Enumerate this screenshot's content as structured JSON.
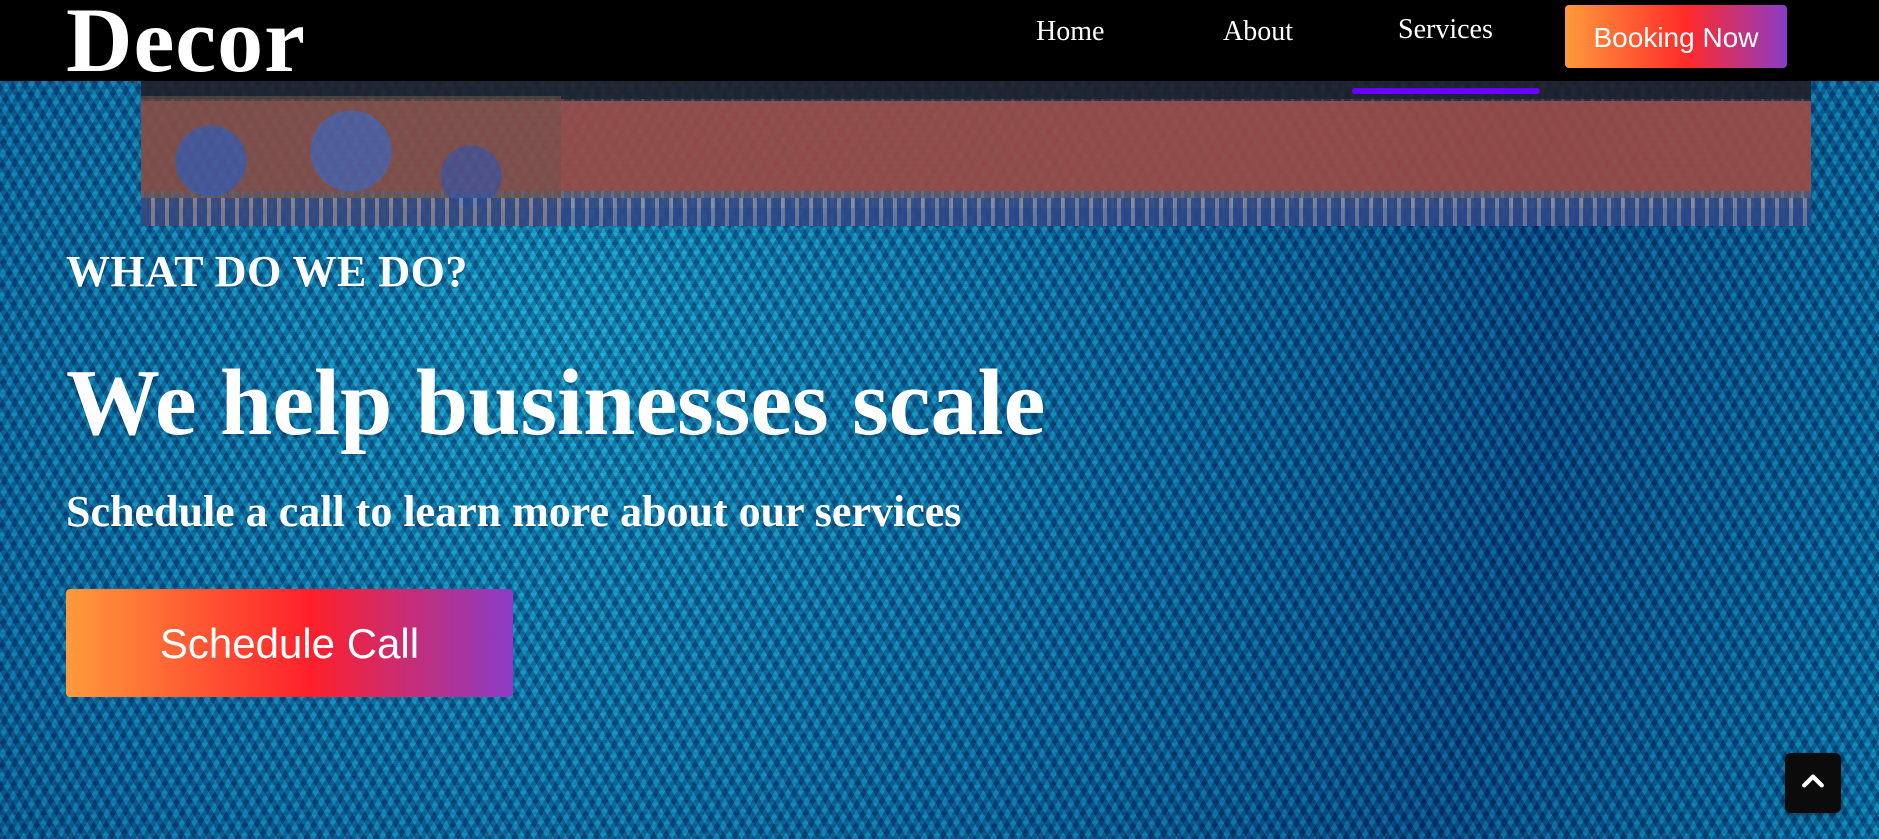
{
  "header": {
    "logo": "Decor",
    "nav": {
      "home": "Home",
      "about": "About",
      "services": "Services",
      "booking": "Booking Now"
    }
  },
  "hero": {
    "kicker": "WHAT DO WE DO?",
    "headline": "We help businesses scale",
    "subhead": "Schedule a call to learn more about our services",
    "cta": "Schedule Call"
  },
  "ui": {
    "active_nav": "Services",
    "colors": {
      "header_bg": "#000000",
      "accent_underline": "#6a00ff",
      "gradient_start": "#ff9a3c",
      "gradient_mid": "#ff1f2b",
      "gradient_end": "#8a3cc7"
    },
    "icons": {
      "back_to_top": "chevron-up-icon"
    }
  }
}
